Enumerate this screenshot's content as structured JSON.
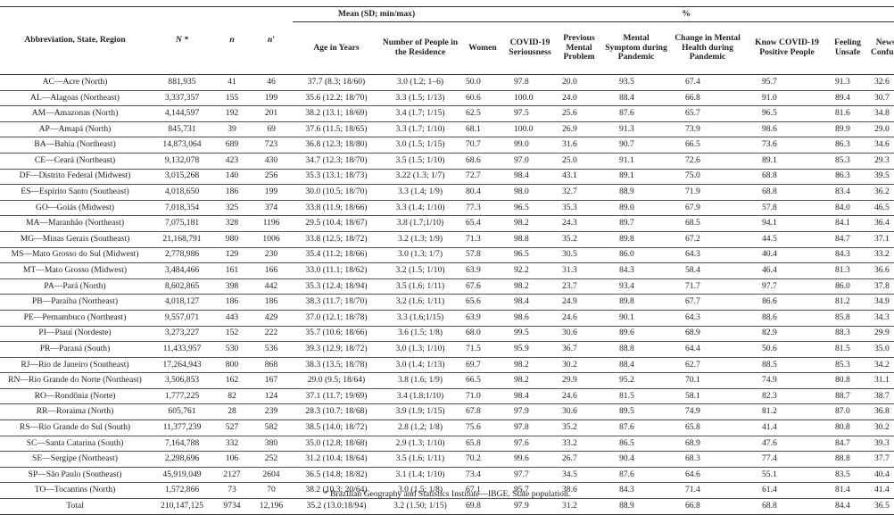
{
  "table": {
    "group_headers": {
      "mean": "Mean (SD; min/max)",
      "percent": "%"
    },
    "columns": [
      "Abbreviation, State, Region",
      "N *",
      "n",
      "n′",
      "Age in Years",
      "Number of People in the Residence",
      "Women",
      "COVID-19 Seriousness",
      "Previous Mental Problem",
      "Mental Symptom during Pandemic",
      "Change in Mental Health during Pandemic",
      "Know COVID-19 Positive People",
      "Feeling Unsafe",
      "News is Confusing"
    ],
    "rows": [
      [
        "AC—Acre (North)",
        "881,935",
        "41",
        "46",
        "37.7 (8.3; 18/60)",
        "3.0 (1.2; 1–6)",
        "50.0",
        "97.8",
        "20.0",
        "93.5",
        "67.4",
        "95.7",
        "91.3",
        "32.6"
      ],
      [
        "AL—Alagoas (Northeast)",
        "3,337,357",
        "155",
        "199",
        "35.6 (12.2; 18/70)",
        "3.3 (1.5; 1/13)",
        "60.6",
        "100.0",
        "24.0",
        "88.4",
        "66.8",
        "91.0",
        "89.4",
        "30.7"
      ],
      [
        "AM—Amazonas (North)",
        "4,144,597",
        "192",
        "201",
        "38.2 (13.1; 18/69)",
        "3.4 (1.7; 1/15)",
        "62.5",
        "97.5",
        "25.6",
        "87.6",
        "65.7",
        "96.5",
        "81.6",
        "34.8"
      ],
      [
        "AP—Amapá (North)",
        "845,731",
        "39",
        "69",
        "37.6 (11.5; 18/65)",
        "3.3 (1.7; 1/10)",
        "68.1",
        "100.0",
        "26.9",
        "91.3",
        "73.9",
        "98.6",
        "89.9",
        "29.0"
      ],
      [
        "BA—Bahia (Northeast)",
        "14,873,064",
        "689",
        "723",
        "36.8 (12.3; 18/80)",
        "3.0 (1.5; 1/15)",
        "70.7",
        "99.0",
        "31.6",
        "90.7",
        "66.5",
        "73.6",
        "86.3",
        "34.6"
      ],
      [
        "CE—Ceará (Northeast)",
        "9,132,078",
        "423",
        "430",
        "34.7 (12.3; 18/70)",
        "3.5 (1.5; 1/10)",
        "68.6",
        "97.0",
        "25.0",
        "91.1",
        "72.6",
        "89.1",
        "85.3",
        "29.3"
      ],
      [
        "DF—Distrito Federal (Midwest)",
        "3,015,268",
        "140",
        "256",
        "35.3 (13.1; 18/73)",
        "3.22 (1.3; 1/7)",
        "72.7",
        "98.4",
        "43.1",
        "89.1",
        "75.0",
        "68.8",
        "86.3",
        "39.5"
      ],
      [
        "ES—Espírito Santo (Southeast)",
        "4,018,650",
        "186",
        "199",
        "30.0 (10.5; 18/70)",
        "3.3 (1.4; 1/9)",
        "80.4",
        "98.0",
        "32.7",
        "88.9",
        "71.9",
        "68.8",
        "83.4",
        "36.2"
      ],
      [
        "GO—Goiás (Midwest)",
        "7,018,354",
        "325",
        "374",
        "33.8 (11.9; 18/66)",
        "3.3 (1.4; 1/10)",
        "77.3",
        "96.5",
        "35.3",
        "89.0",
        "67.9",
        "57.8",
        "84.0",
        "46.5"
      ],
      [
        "MA—Maranhão (Northeast)",
        "7,075,181",
        "328",
        "1196",
        "29.5 (10.4; 18/67)",
        "3.8 (1.7;1/10)",
        "65.4",
        "98.2",
        "24.3",
        "89.7",
        "68.5",
        "94.1",
        "84.1",
        "36.4"
      ],
      [
        "MG—Minas Gerais (Southeast)",
        "21,168,791",
        "980",
        "1006",
        "33.8 (12.5; 18/72)",
        "3.2 (1.3; 1/9)",
        "71.3",
        "98.8",
        "35.2",
        "89.8",
        "67.2",
        "44.5",
        "84.7",
        "37.1"
      ],
      [
        "MS—Mato Grosso do Sul (Midwest)",
        "2,778,986",
        "129",
        "230",
        "35.4 (11.2; 18/66)",
        "3.0 (1.3; 1/7)",
        "57.8",
        "96.5",
        "30.5",
        "86.0",
        "64.3",
        "40.4",
        "84.3",
        "33.2"
      ],
      [
        "MT—Mato Grosso (Midwest)",
        "3,484,466",
        "161",
        "166",
        "33.0 (11.1; 18/62)",
        "3.2 (1.5; 1/10)",
        "63.9",
        "92.2",
        "31.3",
        "84.3",
        "58.4",
        "46.4",
        "81.3",
        "36.6"
      ],
      [
        "PA—Pará (North)",
        "8,602,865",
        "398",
        "442",
        "35.3 (12.4; 18/94)",
        "3.5 (1.6; 1/11)",
        "67.6",
        "98.2",
        "23.7",
        "93.4",
        "71.7",
        "97.7",
        "86.0",
        "37.8"
      ],
      [
        "PB—Paraíba (Northeast)",
        "4,018,127",
        "186",
        "186",
        "38.3 (11.7; 18/70)",
        "3.2 (1.6; 1/11)",
        "65.6",
        "98.4",
        "24.9",
        "89.8",
        "67.7",
        "86.6",
        "81.2",
        "34.9"
      ],
      [
        "PE—Pernambuco (Northeast)",
        "9,557,071",
        "443",
        "429",
        "37.0 (12.1; 18/78)",
        "3.3 (1.6;1/15)",
        "63.9",
        "98.6",
        "24.6",
        "90.1",
        "64.3",
        "88.6",
        "85.8",
        "34.3"
      ],
      [
        "PI—Piauí (Nordeste)",
        "3,273,227",
        "152",
        "222",
        "35.7 (10.6; 18/66)",
        "3.6 (1.5; 1/8)",
        "68.0",
        "99.5",
        "30.6",
        "89.6",
        "68.9",
        "82.9",
        "88.3",
        "29.9"
      ],
      [
        "PR—Paraná (South)",
        "11,433,957",
        "530",
        "536",
        "39.3 (12.9; 18/72)",
        "3.0 (1.3; 1/10)",
        "71.5",
        "95.9",
        "36.7",
        "88.8",
        "64.4",
        "50.6",
        "81.5",
        "35.0"
      ],
      [
        "RJ—Rio de Janeiro (Southeast)",
        "17,264,943",
        "800",
        "868",
        "38.3 (13.5; 18/78)",
        "3.0 (1.4; 1/13)",
        "69.7",
        "98.2",
        "30.2",
        "88.4",
        "62.7",
        "88.5",
        "85.3",
        "34.2"
      ],
      [
        "RN—Rio Grande do Norte (Northeast)",
        "3,506,853",
        "162",
        "167",
        "29.0 (9.5; 18/64)",
        "3.8 (1.6; 1/9)",
        "66.5",
        "98.2",
        "29.9",
        "95.2",
        "70.1",
        "74.9",
        "80.8",
        "31.1"
      ],
      [
        "RO—Rondônia (Norte)",
        "1,777,225",
        "82",
        "124",
        "37.1 (11.7; 19/69)",
        "3.4 (1.8;1/10)",
        "71.0",
        "98.4",
        "24.6",
        "81.5",
        "58.1",
        "82.3",
        "88.7",
        "38.7"
      ],
      [
        "RR—Roraima (North)",
        "605,761",
        "28",
        "239",
        "28.3 (10.7; 18/68)",
        "3.9 (1.9; 1/15)",
        "67.8",
        "97.9",
        "30.6",
        "89.5",
        "74.9",
        "81.2",
        "87.0",
        "36.8"
      ],
      [
        "RS—Rio Grande do Sul (South)",
        "11,377,239",
        "527",
        "582",
        "38.5 (14.0; 18/72)",
        "2.8 (1.2; 1/8)",
        "75.6",
        "97.8",
        "35.2",
        "87.6",
        "65.8",
        "41.4",
        "80.8",
        "30.2"
      ],
      [
        "SC—Santa Catarina (South)",
        "7,164,788",
        "332",
        "380",
        "35.0 (12.8; 18/68)",
        "2.9 (1.3; 1/10)",
        "65.8",
        "97.6",
        "33.2",
        "86.5",
        "68.9",
        "47.6",
        "84.7",
        "39.3"
      ],
      [
        "SE—Sergipe (Northeast)",
        "2,298,696",
        "106",
        "252",
        "31.2 (10.4; 18/64)",
        "3.5 (1.6; 1/11)",
        "70.2",
        "99.6",
        "26.7",
        "90.4",
        "68.3",
        "77.4",
        "88.8",
        "37.7"
      ],
      [
        "SP—São Paulo (Southeast)",
        "45,919,049",
        "2127",
        "2604",
        "36.5 (14.8; 18/82)",
        "3.1 (1.4; 1/10)",
        "73.4",
        "97.7",
        "34.5",
        "87.6",
        "64.6",
        "55.1",
        "83.5",
        "40.4"
      ],
      [
        "TO—Tocantins (North)",
        "1,572,866",
        "73",
        "70",
        "38.2 (10.3; 20/64)",
        "3.0 (1.5; 1/8)",
        "67.1",
        "95.7",
        "38.6",
        "84.3",
        "71.4",
        "61.4",
        "81.4",
        "41.4"
      ],
      [
        "Total",
        "210,147,125",
        "9734",
        "12,196",
        "35.2 (13.0;18/94)",
        "3.2 (1.50; 1/15)",
        "69.8",
        "97.9",
        "31.2",
        "88.9",
        "66.8",
        "68.8",
        "84.4",
        "36.5"
      ]
    ]
  },
  "footnote": "* Brazilian Geography and Statistics Institute—IBGE. State population."
}
